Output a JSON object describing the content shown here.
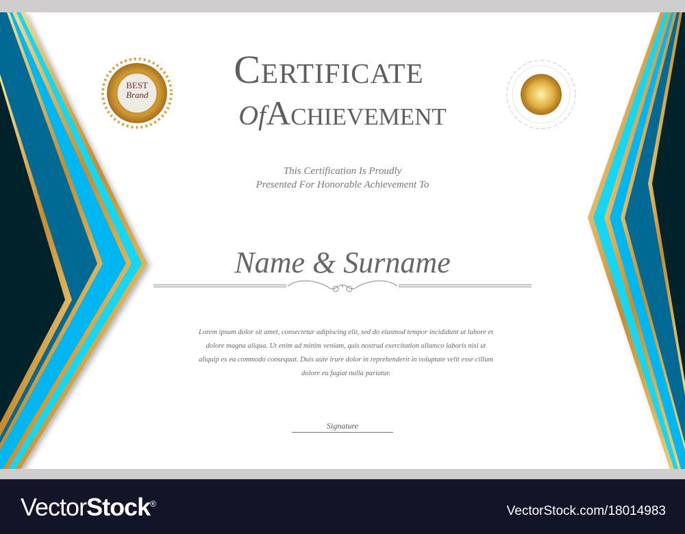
{
  "certificate": {
    "title_line1": "Certificate",
    "title_of": "Of",
    "title_line2": "Achievement",
    "presented_line1": "This Certification Is Proudly",
    "presented_line2": "Presented For Honorable Achievement To",
    "recipient_name": "Name & Surname",
    "body_text": "Lorem ipsum dolor sit amet, consectetur adipiscing elit, sed do eiusmod tempor incididunt ut labore et dolore magna aliqua. Ut enim ad minim veniam, quis nostrud exercitation ullamco laboris nisi ut aliquip ex ea commodo consequat. Duis aute irure dolor in reprehenderit in voluptate velit esse cillum dolore eu fugiat nulla pariatur.",
    "signature_label": "Signature",
    "badge_left": {
      "line1": "BEST",
      "line2": "Brand",
      "icon": "gold-laurel-badge-icon"
    },
    "badge_right": {
      "icon": "gold-rosette-seal-icon"
    }
  },
  "footer": {
    "logo_light": "Vector",
    "logo_bold": "Stock",
    "logo_mark": "®",
    "reference": "VectorStock.com/18014983"
  },
  "colors": {
    "dark_navy": "#03202c",
    "teal": "#056a95",
    "sky": "#00b6f0",
    "cyan": "#12d6f5",
    "gold": "#d4a24a",
    "footer_bg": "#121427",
    "text_gray": "#5e5e5e"
  }
}
